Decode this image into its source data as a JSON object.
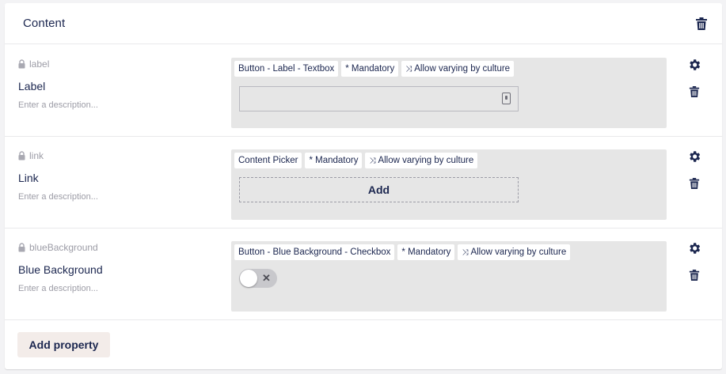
{
  "group": {
    "title": "Content"
  },
  "properties": [
    {
      "alias": "label",
      "name": "Label",
      "description_placeholder": "Enter a description...",
      "tags": [
        "Button - Label - Textbox",
        "* Mandatory",
        "Allow varying by culture"
      ],
      "editor": "textbox",
      "editor_icon": "textbox-icon"
    },
    {
      "alias": "link",
      "name": "Link",
      "description_placeholder": "Enter a description...",
      "tags": [
        "Content Picker",
        "* Mandatory",
        "Allow varying by culture"
      ],
      "editor": "content-picker",
      "add_label": "Add"
    },
    {
      "alias": "blueBackground",
      "name": "Blue Background",
      "description_placeholder": "Enter a description...",
      "tags": [
        "Button - Blue Background - Checkbox",
        "* Mandatory",
        "Allow varying by culture"
      ],
      "editor": "toggle",
      "toggle_on": false,
      "toggle_off_symbol": "✕"
    }
  ],
  "icons": {
    "lock": "lock-icon",
    "settings": "gear-icon",
    "delete": "trash-icon",
    "vary": "shuffle-icon",
    "vary_glyph": "⤨"
  },
  "actions": {
    "add_property_label": "Add property"
  },
  "colors": {
    "text": "#1b264f",
    "muted": "#9c9ca6",
    "editor_bg": "#e6e6e6",
    "add_property_bg": "#f3ece9"
  }
}
